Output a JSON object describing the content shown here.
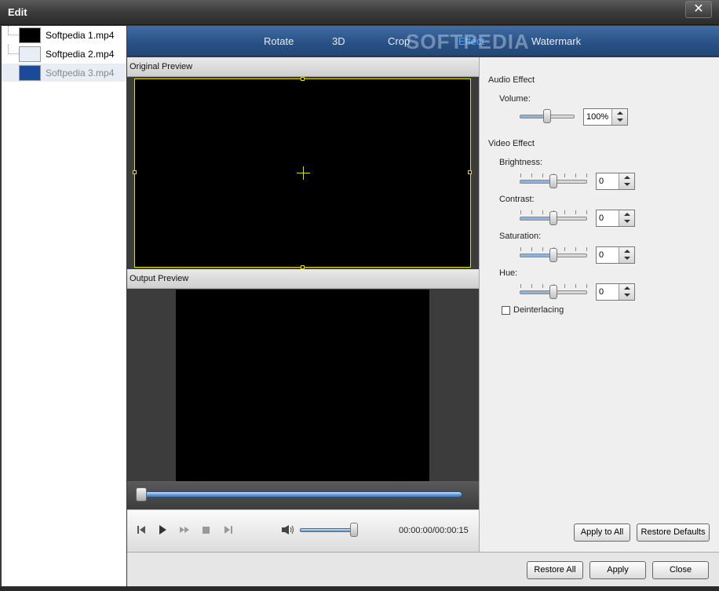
{
  "window": {
    "title": "Edit",
    "close_glyph": "✕"
  },
  "files": [
    {
      "name": "Softpedia 1.mp4",
      "thumb_color": "#000000"
    },
    {
      "name": "Softpedia 2.mp4",
      "thumb_color": "#e8eef8"
    },
    {
      "name": "Softpedia 3.mp4",
      "thumb_color": "#1b4a9a"
    }
  ],
  "tabs": [
    {
      "label": "Rotate"
    },
    {
      "label": "3D"
    },
    {
      "label": "Crop"
    },
    {
      "label": "Effect",
      "active": true
    },
    {
      "label": "Watermark"
    }
  ],
  "watermark": "SOFTPEDIA",
  "preview": {
    "original_label": "Original Preview",
    "output_label": "Output Preview"
  },
  "player": {
    "timecode": "00:00:00/00:00:15",
    "seek_position": 0.0,
    "volume_level": 0.95
  },
  "audio": {
    "heading": "Audio Effect",
    "volume_label": "Volume:",
    "volume_value": "100%",
    "volume_level": 0.5
  },
  "video": {
    "heading": "Video Effect",
    "brightness_label": "Brightness:",
    "brightness_value": "0",
    "contrast_label": "Contrast:",
    "contrast_value": "0",
    "saturation_label": "Saturation:",
    "saturation_value": "0",
    "hue_label": "Hue:",
    "hue_value": "0",
    "deinterlacing_label": "Deinterlacing",
    "deinterlacing_checked": false
  },
  "buttons": {
    "apply_to_all": "Apply to All",
    "restore_defaults": "Restore Defaults",
    "restore_all": "Restore All",
    "apply": "Apply",
    "close": "Close"
  },
  "colors": {
    "tab_active": "#46a8ff",
    "crop_frame": "#e0e000",
    "tabbar": "#2a5287"
  },
  "icons": [
    "skip-back-icon",
    "play-icon",
    "fast-forward-icon",
    "stop-icon",
    "skip-end-icon",
    "speaker-icon"
  ]
}
